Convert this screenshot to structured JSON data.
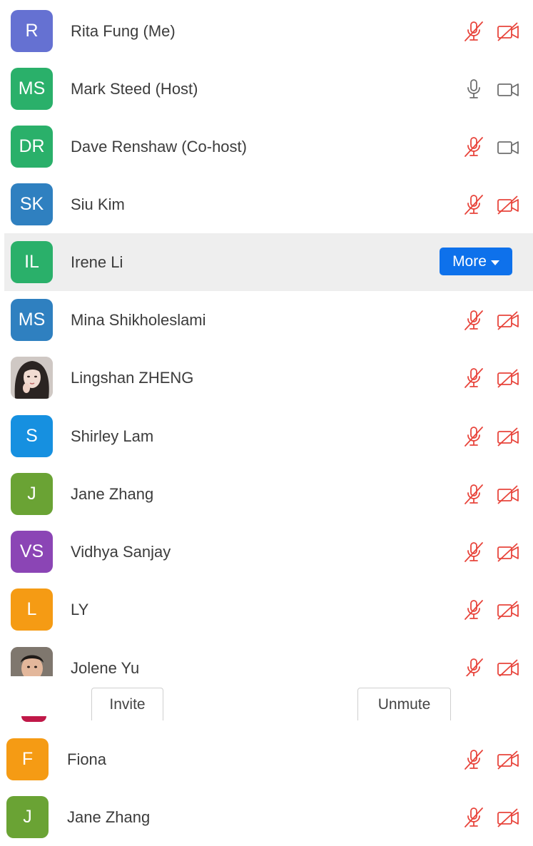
{
  "colors": {
    "muted_red": "#e8453c",
    "icon_gray": "#6e6e6e",
    "more_button_bg": "#0e71eb",
    "row_highlight": "#eeeeee"
  },
  "participants": [
    {
      "initials": "R",
      "name": "Rita Fung (Me)",
      "color": "#6571d2",
      "mic": "muted",
      "cam": "off"
    },
    {
      "initials": "MS",
      "name": "Mark Steed (Host)",
      "color": "#2ab06a",
      "mic": "on",
      "cam": "on"
    },
    {
      "initials": "DR",
      "name": "Dave Renshaw (Co-host)",
      "color": "#2ab06a",
      "mic": "muted",
      "cam": "on"
    },
    {
      "initials": "SK",
      "name": "Siu Kim",
      "color": "#2f80c0",
      "mic": "muted",
      "cam": "off"
    },
    {
      "initials": "IL",
      "name": "Irene Li",
      "color": "#2ab06a",
      "more_label": "More"
    },
    {
      "initials": "MS",
      "name": "Mina Shikholeslami",
      "color": "#2f80c0",
      "mic": "muted",
      "cam": "off"
    },
    {
      "initials": "",
      "name": "Lingshan ZHENG",
      "photo": "portrait-woman",
      "mic": "muted",
      "cam": "off"
    },
    {
      "initials": "S",
      "name": "Shirley Lam",
      "color": "#1690e0",
      "mic": "muted",
      "cam": "off"
    },
    {
      "initials": "J",
      "name": "Jane Zhang",
      "color": "#6aa334",
      "mic": "muted",
      "cam": "off"
    },
    {
      "initials": "VS",
      "name": "Vidhya Sanjay",
      "color": "#8b45b5",
      "mic": "muted",
      "cam": "off"
    },
    {
      "initials": "L",
      "name": "LY",
      "color": "#f59b14",
      "mic": "muted",
      "cam": "off"
    },
    {
      "initials": "",
      "name": "Jolene Yu",
      "photo": "portrait-child",
      "mic": "muted",
      "cam": "off"
    },
    {
      "initials": "F",
      "name": "Fiona",
      "color": "#f59b14",
      "mic": "muted",
      "cam": "off"
    },
    {
      "initials": "J",
      "name": "Jane Zhang",
      "color": "#6aa334",
      "mic": "muted",
      "cam": "off"
    }
  ],
  "actions": {
    "invite_label": "Invite",
    "unmute_label": "Unmute"
  }
}
